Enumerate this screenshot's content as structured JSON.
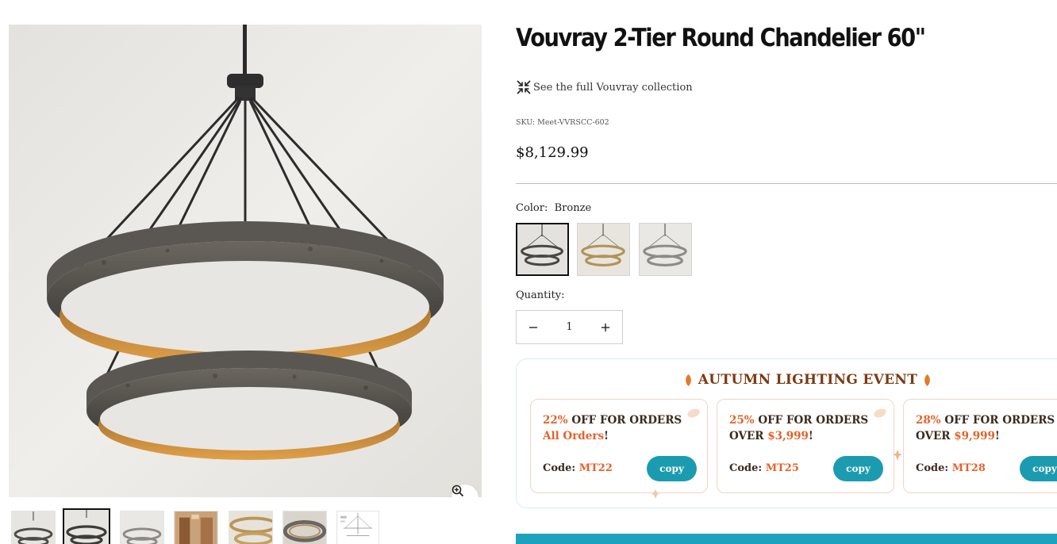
{
  "product": {
    "title": "Vouvray 2-Tier Round Chandelier 60\"",
    "collection_link": "See the full Vouvray collection",
    "collection_icon": "collapse-arrows-icon",
    "sku": "SKU: Meet-VVRSCC-602",
    "price": "$8,129.99"
  },
  "options": {
    "color_label": "Color:",
    "color_value": "Bronze",
    "swatches": [
      "Bronze",
      "Brass",
      "Silver"
    ],
    "quantity_label": "Quantity:",
    "quantity_value": "1",
    "minus_icon": "minus-icon",
    "plus_icon": "plus-icon"
  },
  "gallery": {
    "zoom_icon": "zoom-in-icon",
    "thumbnails": [
      "Bronze front",
      "Bronze alternate",
      "Silver",
      "Room scene",
      "Brass detail",
      "Ring detail",
      "Dimensions drawing"
    ],
    "active_thumbnail": 1
  },
  "promo": {
    "heading": "AUTUMN LIGHTING EVENT",
    "coupons": [
      {
        "percent": "22%",
        "middle": " OFF FOR ORDERS",
        "line2_pre": "",
        "line2_hl": "All Orders",
        "line2_post": "!",
        "code_label": "Code:",
        "code": "MT22",
        "button": "copy"
      },
      {
        "percent": "25%",
        "middle": " OFF FOR ORDERS",
        "line2_pre": "OVER ",
        "line2_hl": "$3,999",
        "line2_post": "!",
        "code_label": "Code:",
        "code": "MT25",
        "button": "copy"
      },
      {
        "percent": "28%",
        "middle": " OFF FOR ORDERS",
        "line2_pre": "OVER ",
        "line2_hl": "$9,999",
        "line2_post": "!",
        "code_label": "Code:",
        "code": "MT28",
        "button": "copy"
      }
    ]
  },
  "colors": {
    "accent_teal": "#1b9bb0",
    "promo_orange": "#e4622a",
    "promo_brown": "#7a3a13"
  }
}
